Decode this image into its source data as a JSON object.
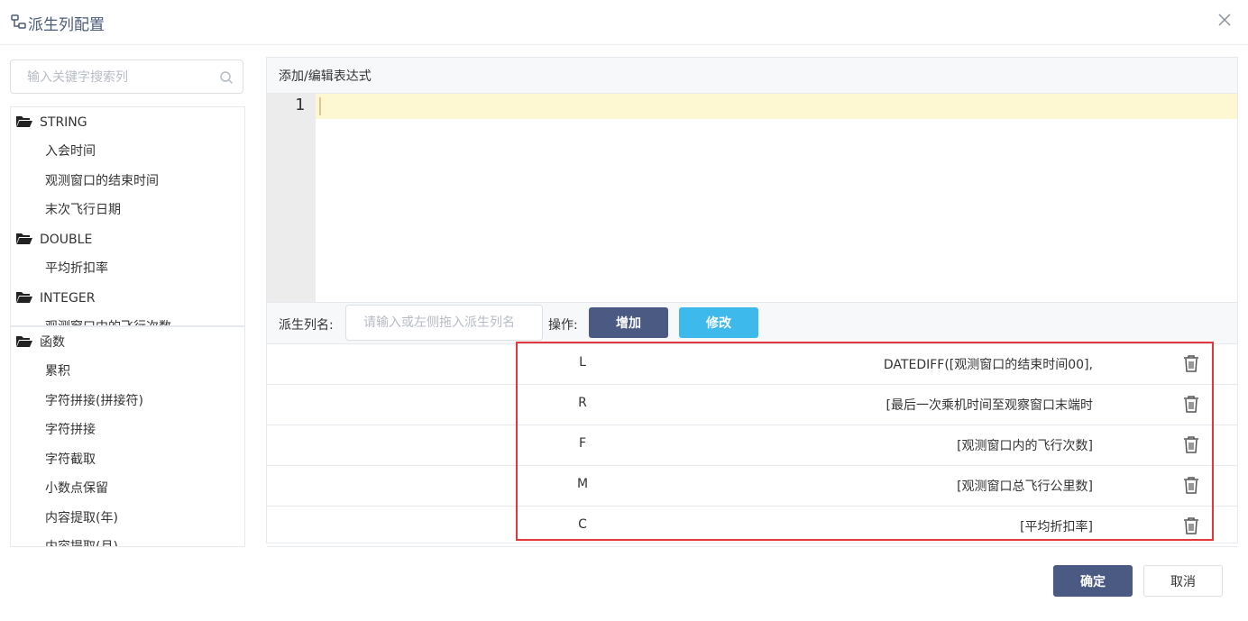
{
  "dialog": {
    "title": "派生列配置",
    "icons": {
      "title": "columns-icon",
      "close": "close-icon"
    }
  },
  "left_panel": {
    "search": {
      "placeholder": "输入关键字搜索列",
      "icon": "search-icon"
    },
    "columns_tree": [
      {
        "type": "STRING",
        "items": [
          "入会时间",
          "观测窗口的结束时间",
          "末次飞行日期"
        ]
      },
      {
        "type": "DOUBLE",
        "items": [
          "平均折扣率"
        ]
      },
      {
        "type": "INTEGER",
        "items": [
          "观测窗口中的飞行次数"
        ]
      }
    ],
    "functions_tree": {
      "label": "函数",
      "items": [
        "累积",
        "字符拼接(拼接符)",
        "字符拼接",
        "字符截取",
        "小数点保留",
        "内容提取(年)",
        "内容提取(月)"
      ]
    }
  },
  "editor": {
    "title": "添加/编辑表达式",
    "line_number": "1",
    "value": ""
  },
  "form": {
    "name_label": "派生列名:",
    "name_placeholder": "请输入或左侧拖入派生列名",
    "ops_label": "操作:",
    "add_button": "增加",
    "edit_button": "修改"
  },
  "derived_columns": [
    {
      "name": "L",
      "expression": "DATEDIFF([观测窗口的结束时间00],",
      "action_icon": "trash-icon"
    },
    {
      "name": "R",
      "expression": "[最后一次乘机时间至观察窗口末端时",
      "action_icon": "trash-icon"
    },
    {
      "name": "F",
      "expression": "[观测窗口内的飞行次数]",
      "action_icon": "trash-icon"
    },
    {
      "name": "M",
      "expression": "[观测窗口总飞行公里数]",
      "action_icon": "trash-icon"
    },
    {
      "name": "C",
      "expression": "[平均折扣率]",
      "action_icon": "trash-icon"
    }
  ],
  "footer": {
    "confirm": "确定",
    "cancel": "取消"
  },
  "colors": {
    "primary": "#4b5a82",
    "info": "#3db9ec",
    "highlight_border": "#e3373c",
    "active_line": "#fdf8d2"
  }
}
